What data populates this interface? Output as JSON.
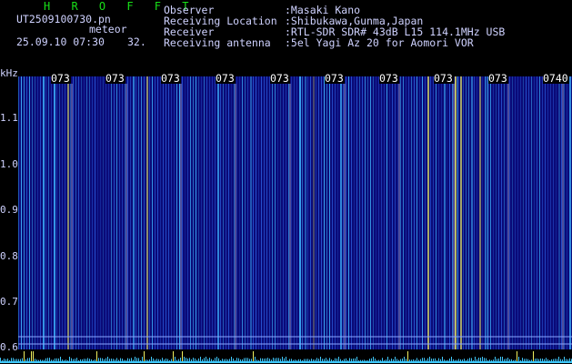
{
  "header": {
    "brand": "H R O F F T",
    "filename": "UT2509100730.pn",
    "filename_suffix": "meteor",
    "datetime": "25.09.10 07:30",
    "value": "32."
  },
  "metadata": [
    {
      "label": "Observer",
      "value": ":Masaki Kano"
    },
    {
      "label": "Receiving Location",
      "value": ":Shibukawa,Gunma,Japan"
    },
    {
      "label": "Receiver",
      "value": ":RTL-SDR SDR# 43dB L15 114.1MHz USB"
    },
    {
      "label": "Receiving antenna",
      "value": ":5el Yagi Az 20 for Aomori VOR"
    }
  ],
  "axis": {
    "unit": "kHz",
    "freq_labels": [
      "1.1",
      "1.0",
      "0.9",
      "0.8",
      "0.7",
      "0.6"
    ],
    "time_labels": [
      "073",
      "073",
      "073",
      "073",
      "073",
      "073",
      "073",
      "073",
      "073",
      "0740"
    ]
  },
  "colors": {
    "background": "#000000",
    "spectrum_base": "#0a0a78",
    "signal": "#3fb6ff",
    "strong_signal": "#f0f060",
    "brand": "#18e018"
  }
}
